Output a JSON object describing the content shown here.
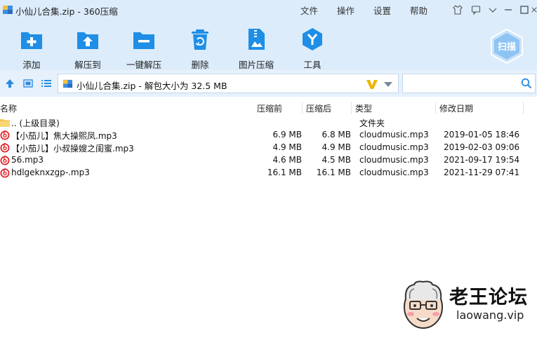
{
  "window": {
    "title": "小仙儿合集.zip - 360压缩",
    "menu": [
      "文件",
      "操作",
      "设置",
      "帮助"
    ]
  },
  "toolbar": {
    "items": [
      {
        "label": "添加",
        "icon": "add-icon"
      },
      {
        "label": "解压到",
        "icon": "extract-to-icon"
      },
      {
        "label": "一键解压",
        "icon": "one-click-extract-icon"
      },
      {
        "label": "删除",
        "icon": "delete-icon"
      },
      {
        "label": "图片压缩",
        "icon": "image-compress-icon"
      },
      {
        "label": "工具",
        "icon": "tools-icon"
      }
    ],
    "scan_label": "扫描"
  },
  "address": {
    "path": "小仙儿合集.zip - 解包大小为 32.5 MB"
  },
  "search": {
    "value": "",
    "placeholder": ""
  },
  "columns": {
    "name": "名称",
    "size": "压缩前",
    "compressed": "压缩后",
    "type": "类型",
    "date": "修改日期"
  },
  "files": [
    {
      "name": ".. (上级目录)",
      "size": "",
      "compressed": "",
      "type": "文件夹",
      "date": "",
      "icon": "folder-icon"
    },
    {
      "name": "【小茄儿】焦大操熙凤.mp3",
      "size": "6.9 MB",
      "compressed": "6.8 MB",
      "type": "cloudmusic.mp3",
      "date": "2019-01-05 18:46",
      "icon": "netease-music-icon"
    },
    {
      "name": "【小茄儿】小叔操嫂之闺蜜.mp3",
      "size": "4.9 MB",
      "compressed": "4.9 MB",
      "type": "cloudmusic.mp3",
      "date": "2019-02-03 09:06",
      "icon": "netease-music-icon"
    },
    {
      "name": "56.mp3",
      "size": "4.6 MB",
      "compressed": "4.5 MB",
      "type": "cloudmusic.mp3",
      "date": "2021-09-17 19:54",
      "icon": "netease-music-icon"
    },
    {
      "name": "hdlgeknxzgp-.mp3",
      "size": "16.1 MB",
      "compressed": "16.1 MB",
      "type": "cloudmusic.mp3",
      "date": "2021-11-29 07:41",
      "icon": "netease-music-icon"
    }
  ],
  "watermark": {
    "title": "老王论坛",
    "url": "laowang.vip"
  },
  "colors": {
    "toolbar_bg": "#dcecfb",
    "accent": "#1e8ee6",
    "music_red": "#e0262b"
  }
}
